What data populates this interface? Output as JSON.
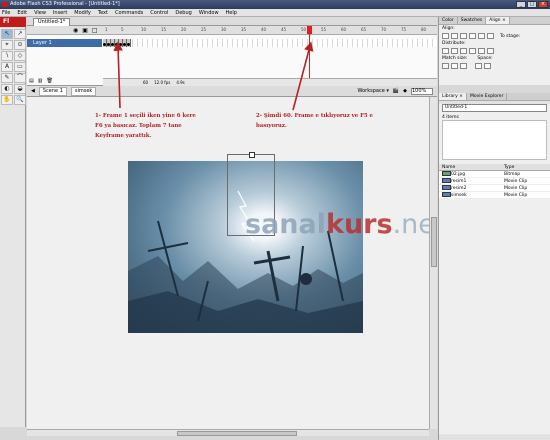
{
  "window": {
    "title": "Adobe Flash CS3 Professional - [Untitled-1*]"
  },
  "menu": [
    "File",
    "Edit",
    "View",
    "Insert",
    "Modify",
    "Text",
    "Commands",
    "Control",
    "Debug",
    "Window",
    "Help"
  ],
  "toolbox": {
    "logo": "Fl",
    "tools": [
      "↖",
      "↗",
      "⌖",
      "⊙",
      "∖",
      "◇",
      "A",
      "▭",
      "✎",
      "⌒",
      "◐",
      "◒",
      "✋",
      "🔍"
    ]
  },
  "document": {
    "tab": "Untitled-1*"
  },
  "timeline": {
    "layer": "Layer 1",
    "ruler": [
      "1",
      "5",
      "10",
      "15",
      "20",
      "25",
      "30",
      "35",
      "40",
      "45",
      "50",
      "55",
      "60",
      "65",
      "70",
      "75",
      "80"
    ],
    "current_frame": "60",
    "fps": "12.0 fps",
    "elapsed": "4.9s"
  },
  "editbar": {
    "scene": "Scene 1",
    "symbol": "simsek",
    "workspace": "Workspace ▾",
    "zoom": "100%"
  },
  "annotations": {
    "left": [
      "1- Frame 1 seçili iken yine 6 kere",
      "F6 ya basıcaz. Toplam 7 tane",
      "Keyframe yarattık."
    ],
    "right": [
      "2- Şimdi 60. Frame e tıklıyoruz ve F5 e",
      "basıyoruz."
    ]
  },
  "watermark": {
    "part1": "sanal",
    "part2": "kurs",
    "part3": ".net"
  },
  "panel": {
    "tabs": [
      "Color",
      "Swatches",
      "Align ×"
    ],
    "align_label": "Align:",
    "distribute_label": "Distribute:",
    "match_label": "Match size:",
    "space_label": "Space:",
    "to_stage": "To stage:",
    "library_tabs": [
      "Library ×",
      "Movie Explorer"
    ],
    "library_select": "Untitled-1",
    "item_count": "4 items",
    "columns": [
      "Name",
      "Type"
    ],
    "items": [
      {
        "name": "02.jpg",
        "type": "Bitmap"
      },
      {
        "name": "resim1",
        "type": "Movie Clip"
      },
      {
        "name": "resim2",
        "type": "Movie Clip"
      },
      {
        "name": "simsek",
        "type": "Movie Clip"
      }
    ]
  },
  "colors": {
    "annotation_red": "#b42222",
    "layer_selected": "#3f6ba8",
    "title_bar": "#2c3a5e",
    "playhead": "#e02020"
  }
}
